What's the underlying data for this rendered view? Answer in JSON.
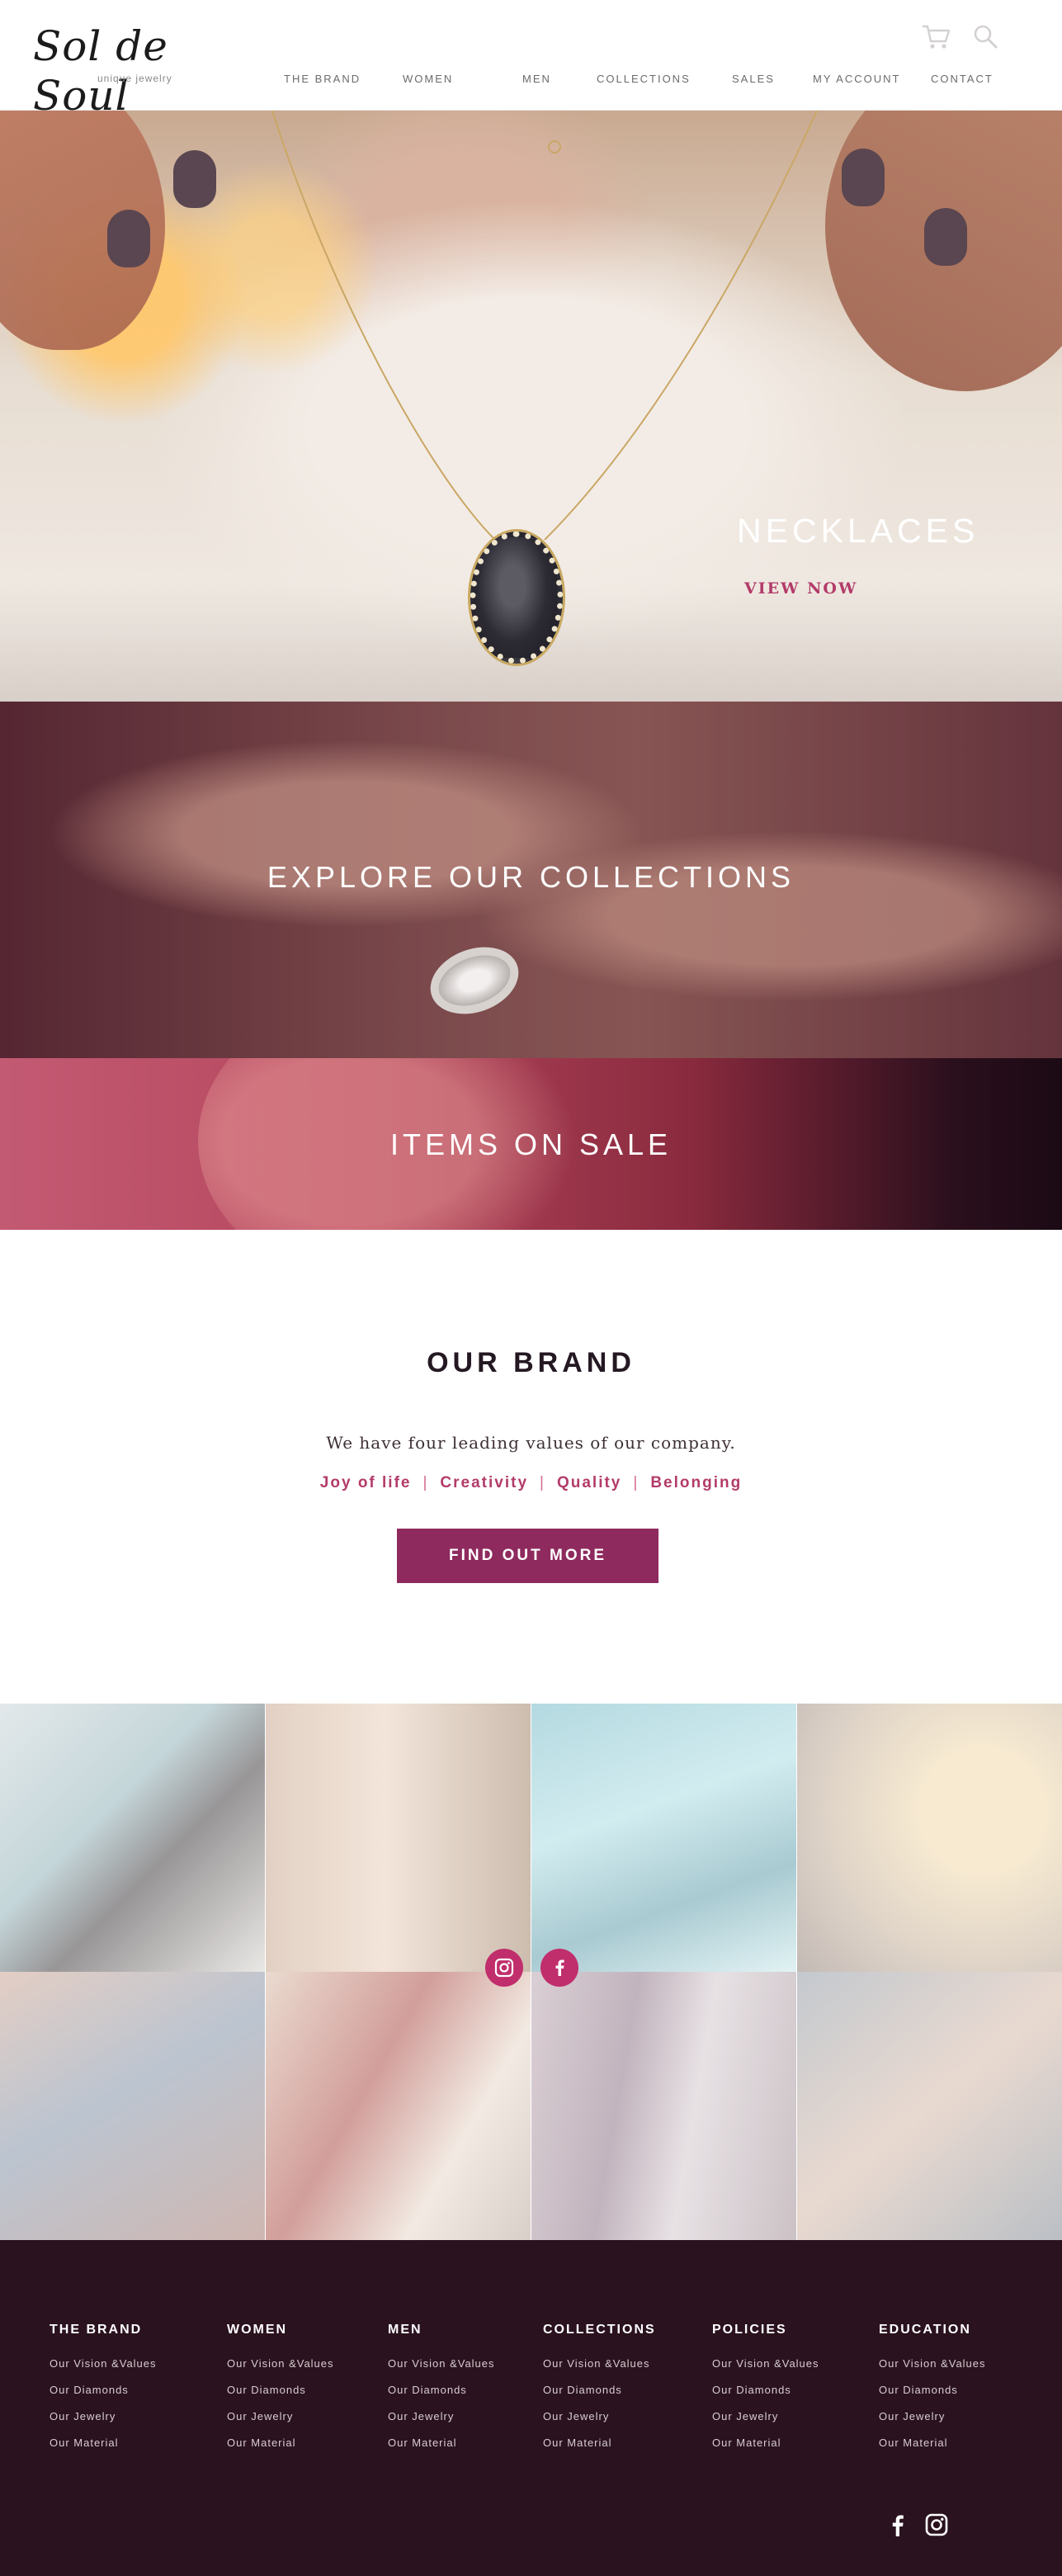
{
  "header": {
    "logo": {
      "name": "Sol de Soul",
      "tagline": "unique jewelry"
    },
    "nav": [
      {
        "label": "THE BRAND"
      },
      {
        "label": "WOMEN"
      },
      {
        "label": "MEN"
      },
      {
        "label": "COLLECTIONS"
      },
      {
        "label": "SALES"
      },
      {
        "label": "MY ACCOUNT"
      },
      {
        "label": "CONTACT"
      }
    ],
    "icons": {
      "cart": "cart-icon",
      "search": "search-icon"
    }
  },
  "hero": {
    "title": "NECKLACES",
    "cta": "VIEW NOW"
  },
  "collections_banner": {
    "title": "EXPLORE OUR COLLECTIONS"
  },
  "sale_banner": {
    "title": "ITEMS ON SALE"
  },
  "brand": {
    "title": "OUR BRAND",
    "text": "We have four leading values of our company.",
    "values": [
      "Joy of life",
      "Creativity",
      "Quality",
      "Belonging"
    ],
    "separator": "|",
    "button": "FIND OUT MORE"
  },
  "gallery": {
    "social_icons": [
      "instagram-icon",
      "facebook-icon"
    ]
  },
  "footer": {
    "columns": [
      {
        "heading": "THE BRAND",
        "links": [
          "Our Vision &Values",
          "Our Diamonds",
          "Our Jewelry",
          "Our Material"
        ]
      },
      {
        "heading": "WOMEN",
        "links": [
          "Our Vision &Values",
          "Our Diamonds",
          "Our Jewelry",
          "Our Material"
        ]
      },
      {
        "heading": "MEN",
        "links": [
          "Our Vision &Values",
          "Our Diamonds",
          "Our Jewelry",
          "Our Material"
        ]
      },
      {
        "heading": "COLLECTIONS",
        "links": [
          "Our Vision &Values",
          "Our Diamonds",
          "Our Jewelry",
          "Our Material"
        ]
      },
      {
        "heading": "POLICIES",
        "links": [
          "Our Vision &Values",
          "Our Diamonds",
          "Our Jewelry",
          "Our Material"
        ]
      },
      {
        "heading": "EDUCATION",
        "links": [
          "Our Vision &Values",
          "Our Diamonds",
          "Our Jewelry",
          "Our Material"
        ]
      }
    ],
    "social_icons": [
      "facebook-icon",
      "instagram-icon"
    ]
  },
  "colors": {
    "accent": "#b33b69",
    "button": "#8e2a5e",
    "social": "#c02e6c",
    "footer_bg": "#2a121e"
  }
}
